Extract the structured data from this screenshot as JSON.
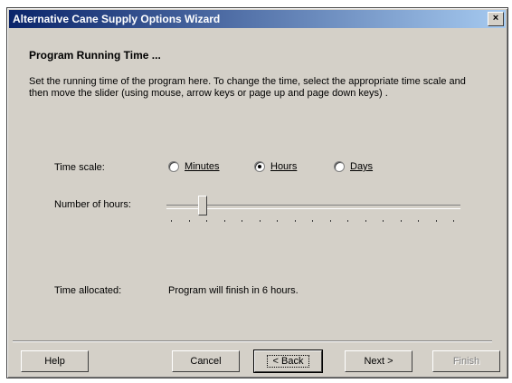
{
  "window": {
    "title": "Alternative Cane Supply Options Wizard",
    "close_glyph": "×"
  },
  "heading": "Program Running Time ...",
  "description": "Set the running time of the program here.  To change the time, select the appropriate time scale and then move the slider (using mouse, arrow keys or page up and page down keys) .",
  "time_scale": {
    "label": "Time scale:",
    "options": [
      {
        "label": "Minutes",
        "selected": false
      },
      {
        "label": "Hours",
        "selected": true
      },
      {
        "label": "Days",
        "selected": false
      }
    ]
  },
  "slider": {
    "label": "Number of hours:",
    "value": 6
  },
  "allocated": {
    "label": "Time allocated:",
    "value": "Program will finish in 6 hours."
  },
  "buttons": {
    "help": "Help",
    "cancel": "Cancel",
    "back": "< Back",
    "next": "Next >",
    "finish": "Finish"
  },
  "colors": {
    "title_start": "#0a246a",
    "title_end": "#a6caf0",
    "face": "#d4d0c8"
  }
}
